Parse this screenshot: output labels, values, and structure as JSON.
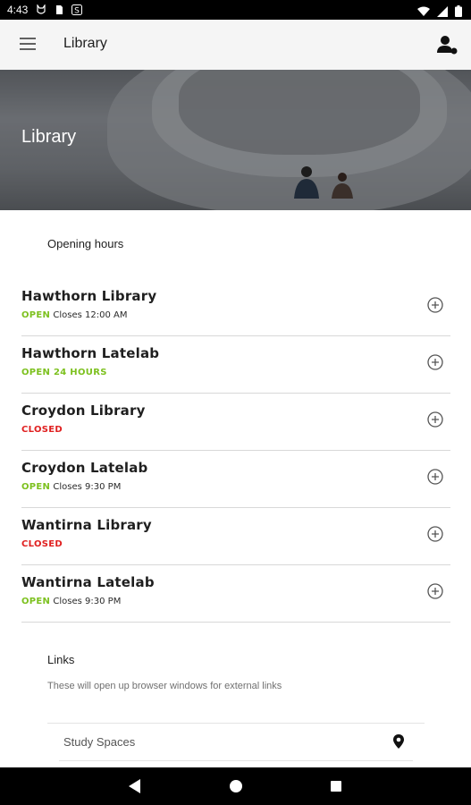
{
  "status_bar": {
    "time": "4:43",
    "left_icons": [
      "cat-icon",
      "sim-icon",
      "s-icon"
    ],
    "right_icons": [
      "wifi-icon",
      "signal-icon",
      "battery-icon"
    ]
  },
  "app_bar": {
    "title": "Library",
    "menu_icon": "hamburger-menu-icon",
    "profile_icon": "person-icon"
  },
  "hero": {
    "title": "Library"
  },
  "opening_hours": {
    "label": "Opening hours",
    "items": [
      {
        "name": "Hawthorn Library",
        "status": "OPEN",
        "detail": "Closes 12:00 AM",
        "status_color": "#7dc11f"
      },
      {
        "name": "Hawthorn Latelab",
        "status": "OPEN 24 HOURS",
        "detail": "",
        "status_color": "#7dc11f"
      },
      {
        "name": "Croydon Library",
        "status": "CLOSED",
        "detail": "",
        "status_color": "#e02020"
      },
      {
        "name": "Croydon Latelab",
        "status": "OPEN",
        "detail": "Closes 9:30 PM",
        "status_color": "#7dc11f"
      },
      {
        "name": "Wantirna Library",
        "status": "CLOSED",
        "detail": "",
        "status_color": "#e02020"
      },
      {
        "name": "Wantirna Latelab",
        "status": "OPEN",
        "detail": "Closes 9:30 PM",
        "status_color": "#7dc11f"
      }
    ]
  },
  "links": {
    "label": "Links",
    "description": "These will open up browser windows for external links",
    "items": [
      {
        "label": "Study Spaces",
        "icon": "location-pin-icon"
      }
    ]
  },
  "nav_bar": {
    "icons": [
      "back-icon",
      "home-icon",
      "recents-icon"
    ]
  }
}
